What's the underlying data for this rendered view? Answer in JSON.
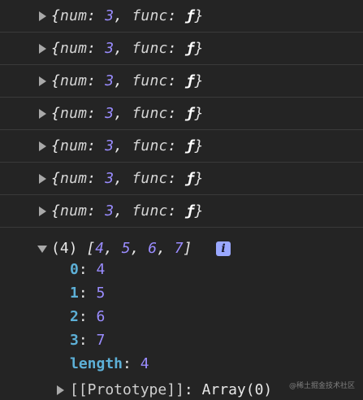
{
  "log_entries": [
    {
      "key1": "num",
      "val1": "3",
      "key2": "func",
      "val2": "ƒ"
    },
    {
      "key1": "num",
      "val1": "3",
      "key2": "func",
      "val2": "ƒ"
    },
    {
      "key1": "num",
      "val1": "3",
      "key2": "func",
      "val2": "ƒ"
    },
    {
      "key1": "num",
      "val1": "3",
      "key2": "func",
      "val2": "ƒ"
    },
    {
      "key1": "num",
      "val1": "3",
      "key2": "func",
      "val2": "ƒ"
    },
    {
      "key1": "num",
      "val1": "3",
      "key2": "func",
      "val2": "ƒ"
    },
    {
      "key1": "num",
      "val1": "3",
      "key2": "func",
      "val2": "ƒ"
    }
  ],
  "array_entry": {
    "length_prefix": "(4)",
    "items": [
      "4",
      "5",
      "6",
      "7"
    ],
    "info_icon": "info-icon",
    "properties": [
      {
        "name": "0",
        "value": "4"
      },
      {
        "name": "1",
        "value": "5"
      },
      {
        "name": "2",
        "value": "6"
      },
      {
        "name": "3",
        "value": "7"
      },
      {
        "name": "length",
        "value": "4"
      }
    ],
    "prototype_label": "[[Prototype]]",
    "prototype_value": "Array(0)"
  },
  "watermark": "@稀土掘金技术社区",
  "colors": {
    "background": "#242424",
    "number": "#9a8cff",
    "property_name": "#5db0d7",
    "info_badge": "#9aa8ff"
  }
}
